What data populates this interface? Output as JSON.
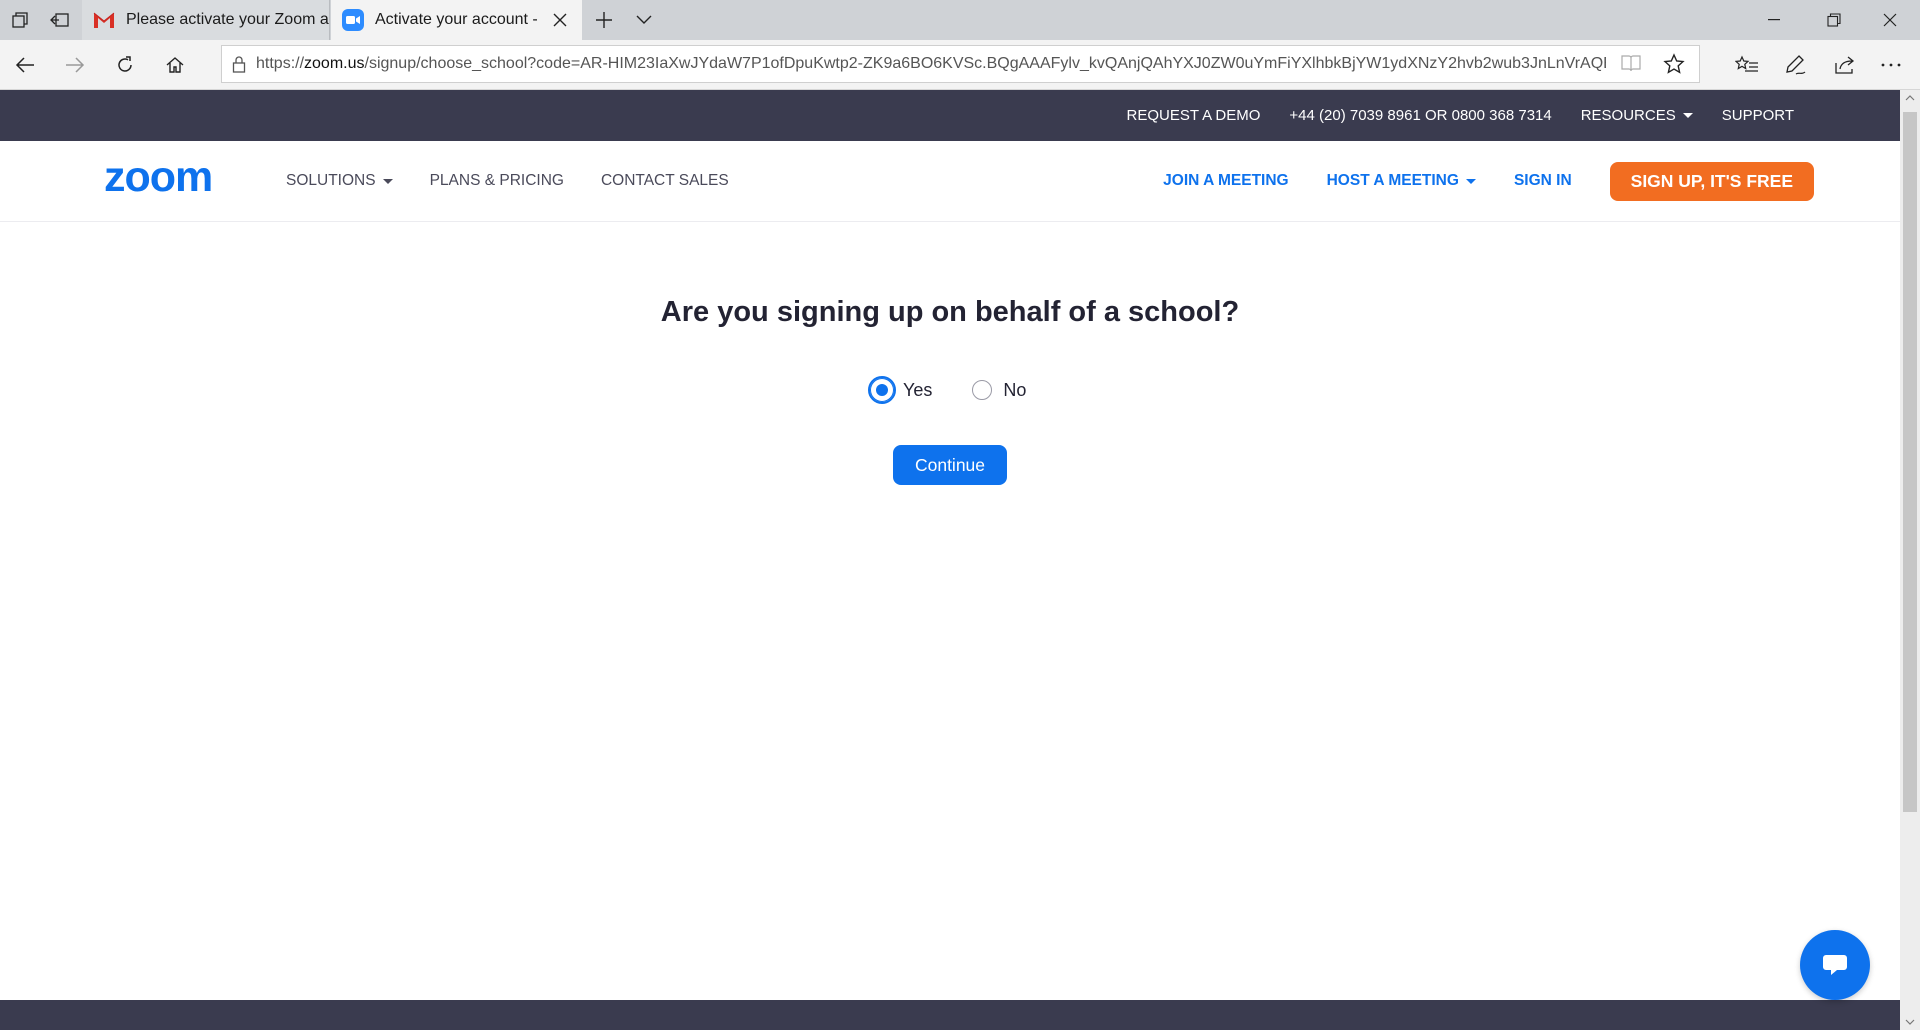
{
  "browser": {
    "tabs": [
      {
        "title": "Please activate your Zoom a",
        "favicon": "gmail-icon",
        "active": false
      },
      {
        "title": "Activate your account -",
        "favicon": "zoom-icon",
        "active": true
      }
    ],
    "url_prefix": "https://",
    "url_host": "zoom.us",
    "url_rest": "/signup/choose_school?code=AR-HIM23IaXwJYdaW7P1ofDpuKwtp2-ZK9a6BO6KVSc.BQgAAAFylv_kvQAnjQAhYXJ0ZW0uYmFiYXlhbkBjYW1ydXNzY2hvb2wub3JnLnVrAQBkA"
  },
  "topbar": {
    "request_demo": "REQUEST A DEMO",
    "phone": "+44 (20) 7039 8961 OR 0800 368 7314",
    "resources": "RESOURCES",
    "support": "SUPPORT"
  },
  "nav": {
    "logo": "zoom",
    "solutions": "SOLUTIONS",
    "plans": "PLANS & PRICING",
    "contact": "CONTACT SALES",
    "join": "JOIN A MEETING",
    "host": "HOST A MEETING",
    "signin": "SIGN IN",
    "signup": "SIGN UP, IT'S FREE"
  },
  "form": {
    "question": "Are you signing up on behalf of a school?",
    "options": [
      {
        "label": "Yes",
        "selected": true
      },
      {
        "label": "No",
        "selected": false
      }
    ],
    "continue": "Continue"
  },
  "colors": {
    "zoom_blue": "#0e72ed",
    "orange": "#f26d21",
    "dark_bar": "#3a3b4f"
  }
}
